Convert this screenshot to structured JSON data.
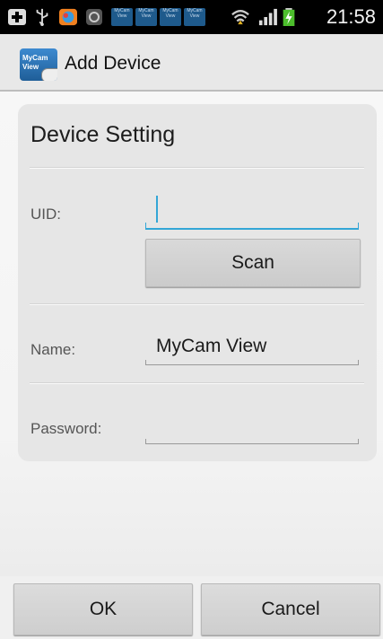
{
  "status_bar": {
    "time": "21:58",
    "mini_app_label": "MyCam View",
    "icons": [
      "add-box-icon",
      "usb-icon",
      "colorful-app-icon",
      "sync-icon",
      "mycam-notification-icon",
      "mycam-notification-icon",
      "mycam-notification-icon",
      "mycam-notification-icon",
      "wifi-icon",
      "signal-icon",
      "battery-charging-icon"
    ]
  },
  "action_bar": {
    "logo_text_line1": "MyCam",
    "logo_text_line2": "View",
    "title": "Add Device"
  },
  "device_setting": {
    "title": "Device Setting",
    "uid_label": "UID:",
    "uid_value": "",
    "scan_label": "Scan",
    "name_label": "Name:",
    "name_value": "MyCam View",
    "password_label": "Password:",
    "password_value": ""
  },
  "buttons": {
    "ok": "OK",
    "cancel": "Cancel"
  },
  "colors": {
    "accent": "#33a6d6",
    "statusbar": "#000000",
    "card": "#e6e6e6"
  }
}
